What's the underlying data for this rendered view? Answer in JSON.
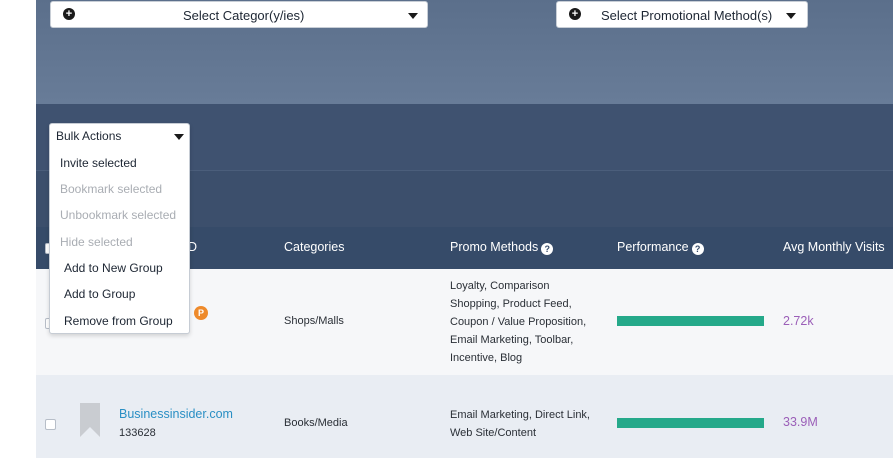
{
  "filters": {
    "category_select": "Select Categor(y/ies)",
    "promo_select": "Select Promotional Method(s)",
    "plus_icon": "plus-circle-icon",
    "caret_icon": "caret-down-icon"
  },
  "bulk_actions": {
    "label": "Bulk Actions",
    "items": [
      {
        "label": "Invite selected",
        "enabled": true
      },
      {
        "label": "Bookmark selected",
        "enabled": false
      },
      {
        "label": "Unbookmark selected",
        "enabled": false
      },
      {
        "label": "Hide selected",
        "enabled": false
      },
      {
        "label": "Add to New Group",
        "enabled": true
      },
      {
        "label": "Add to Group",
        "enabled": true
      },
      {
        "label": "Remove from Group",
        "enabled": true
      }
    ]
  },
  "table": {
    "headers": {
      "partial_id": "D",
      "categories": "Categories",
      "promo_methods": "Promo Methods",
      "performance": "Performance",
      "avg_visits": "Avg Monthly Visits"
    },
    "help_icon": "question-circle-icon",
    "rows": [
      {
        "name": "",
        "id": "",
        "badge": "P",
        "category": "Shops/Malls",
        "promo_lines": [
          "Loyalty, Comparison",
          "Shopping, Product Feed,",
          "Coupon / Value Proposition,",
          "Email Marketing, Toolbar,",
          "Incentive, Blog"
        ],
        "performance": 1.0,
        "visits": "2.72k"
      },
      {
        "name": "Businessinsider.com",
        "id": "133628",
        "category": "Books/Media",
        "promo_lines": [
          "Email Marketing, Direct Link,",
          "Web Site/Content"
        ],
        "performance": 1.0,
        "visits": "33.9M"
      }
    ]
  },
  "colors": {
    "filter_band": "#5b6f8b",
    "header_band": "#364b69",
    "performance_bar": "#25a98a",
    "visits_text": "#9b5fb8",
    "link": "#2a8fc4",
    "badge": "#ee8a2b"
  }
}
